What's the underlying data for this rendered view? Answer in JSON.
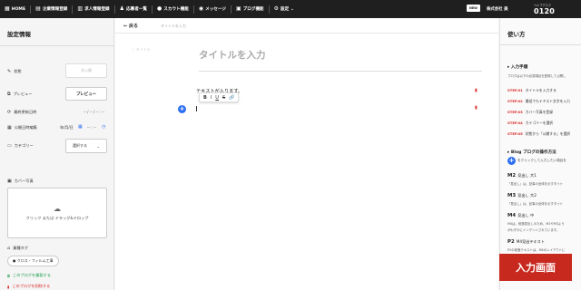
{
  "nav": {
    "items": [
      {
        "icon": "home-icon",
        "glyph": "▦",
        "label": "HOME"
      },
      {
        "icon": "building-icon",
        "glyph": "▤",
        "label": "企業情報登録"
      },
      {
        "icon": "document-icon",
        "glyph": "▥",
        "label": "求人情報登録"
      },
      {
        "icon": "person-icon",
        "glyph": "♟",
        "label": "応募者一覧"
      },
      {
        "icon": "chat-icon",
        "glyph": "●",
        "label": "スカウト機能"
      },
      {
        "icon": "message-icon",
        "glyph": "◉",
        "label": "メッセージ"
      },
      {
        "icon": "blog-icon",
        "glyph": "▣",
        "label": "ブログ機能"
      },
      {
        "icon": "gear-icon",
        "glyph": "⚙",
        "label": "設定 ⌄"
      }
    ],
    "new_badge": "NEW",
    "company": "株式会社 美",
    "help_text": "ヘルプデスク",
    "phone": "0120"
  },
  "left": {
    "title": "設定情報",
    "status_label": "状態",
    "status_value": "非公開",
    "preview_label": "プレビュー",
    "preview_button": "プレビュー",
    "last_updated_label": "最終更新日時",
    "last_updated_value": "-- / -- / -- : --",
    "publish_label": "公開日時編集",
    "publish_date": "年/月/日",
    "publish_time": "-- : --",
    "category_label": "カテゴリー",
    "category_select": "選択する",
    "cover_label": "カバー写真",
    "upload_text": "クリック または ドラッグ&ドロップ",
    "tag_label": "業種タグ",
    "tag_chip": "クロス・フィルム工事",
    "copy_link": "このブログを複製する",
    "delete_link": "このブログを削除する"
  },
  "editor": {
    "back_label": "戻る",
    "breadcrumb": "タイトルを入力",
    "title_side_label": "タイトル",
    "title_placeholder": "タイトルを入力",
    "paragraph_text": "テキストが入ります。",
    "toolbar": [
      "B",
      "I",
      "U",
      "S",
      "🔗"
    ]
  },
  "right": {
    "title": "使い方",
    "input_steps_heading": "入力手順",
    "input_steps_sub": "ブログは以下の必須項目を登録して公開し",
    "steps": [
      {
        "num": "STEP.01",
        "text": "タイトルを入力する"
      },
      {
        "num": "STEP.02",
        "text": "最低でもテキスト文字を入力"
      },
      {
        "num": "STEP.03",
        "text": "カバー写真を登録"
      },
      {
        "num": "STEP.04",
        "text": "カテゴリーを選択"
      },
      {
        "num": "STEP.05",
        "text": "状態から「公開する」を選択"
      }
    ],
    "blog_heading": "Blog ブログの操作方法",
    "fab_hint": "をクリックして入力したい項目を",
    "headings": [
      {
        "tag": "M2",
        "name": "見出し 大1",
        "desc": "「見出し」は、記事の全体を示すタイト"
      },
      {
        "tag": "M3",
        "name": "見出し 大2",
        "desc": "「見出し」は、記事の全体を示すタイト"
      },
      {
        "tag": "M4",
        "name": "見出し 中",
        "desc": "M4は、段落見出しのため、M2やM3よう"
      },
      {
        "tag": "P2",
        "name": "M4見出テキスト",
        "desc": "P2の段落テキストは、M4のレイアウトに"
      }
    ],
    "extra_line": "がわずかにインデントされています。"
  },
  "badge": "入力画面"
}
